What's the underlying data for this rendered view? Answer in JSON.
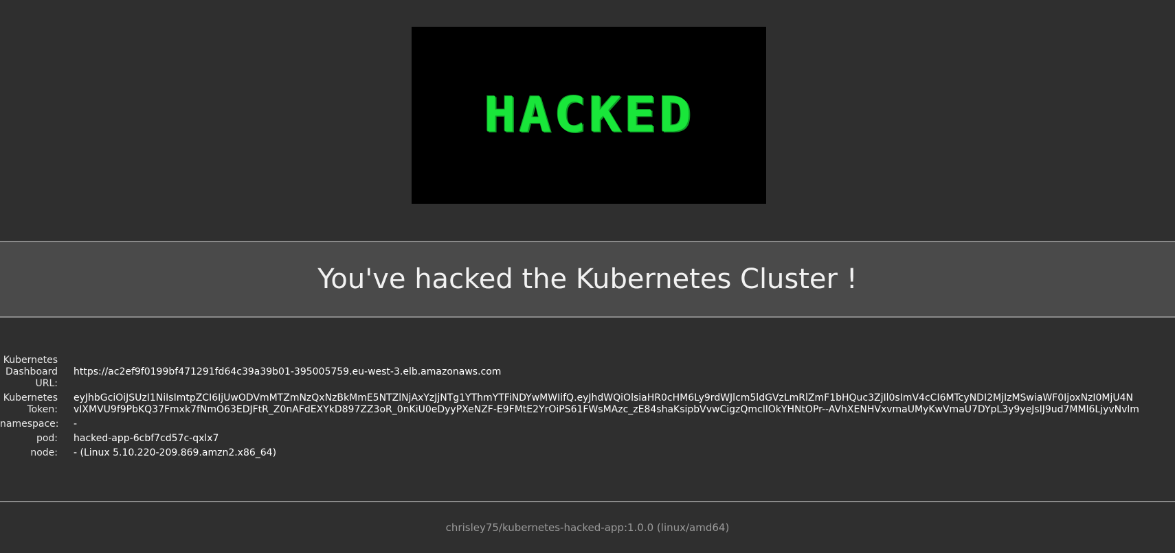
{
  "logo": {
    "text": "HACKED",
    "color": "#19e63a",
    "background": "#000000"
  },
  "banner": {
    "title": "You've hacked the Kubernetes Cluster !"
  },
  "info": {
    "dashboard_label": "Kubernetes Dashboard URL:",
    "dashboard_value": "https://ac2ef9f0199bf471291fd64c39a39b01-395005759.eu-west-3.elb.amazonaws.com",
    "token_label": "Kubernetes Token:",
    "token_line1": "eyJhbGciOiJSUzI1NiIsImtpZCI6IjUwODVmMTZmNzQxNzBkMmE5NTZlNjAxYzJjNTg1YThmYTFiNDYwMWIifQ.eyJhdWQiOlsiaHR0cHM6Ly9rdWJlcm5ldGVzLmRlZmF1bHQuc3ZjIl0sImV4cCI6MTcyNDI2MjIzMSwiaWF0IjoxNzI0MjU4N",
    "token_line2": "vIXMVU9f9PbKQ37Fmxk7fNmO63EDJFtR_Z0nAFdEXYkD897ZZ3oR_0nKiU0eDyyPXeNZF-E9FMtE2YrOiPS61FWsMAzc_zE84shaKsipbVvwCigzQmcIlOkYHNtOPr--AVhXENHVxvmaUMyKwVmaU7DYpL3y9yeJsIJ9ud7MMl6LjyvNvlm",
    "namespace_label": "namespace:",
    "namespace_value": "-",
    "pod_label": "pod:",
    "pod_value": "hacked-app-6cbf7cd57c-qxlx7",
    "node_label": "node:",
    "node_value": "- (Linux 5.10.220-209.869.amzn2.x86_64)"
  },
  "footer": {
    "text": "chrisley75/kubernetes-hacked-app:1.0.0 (linux/amd64)"
  }
}
